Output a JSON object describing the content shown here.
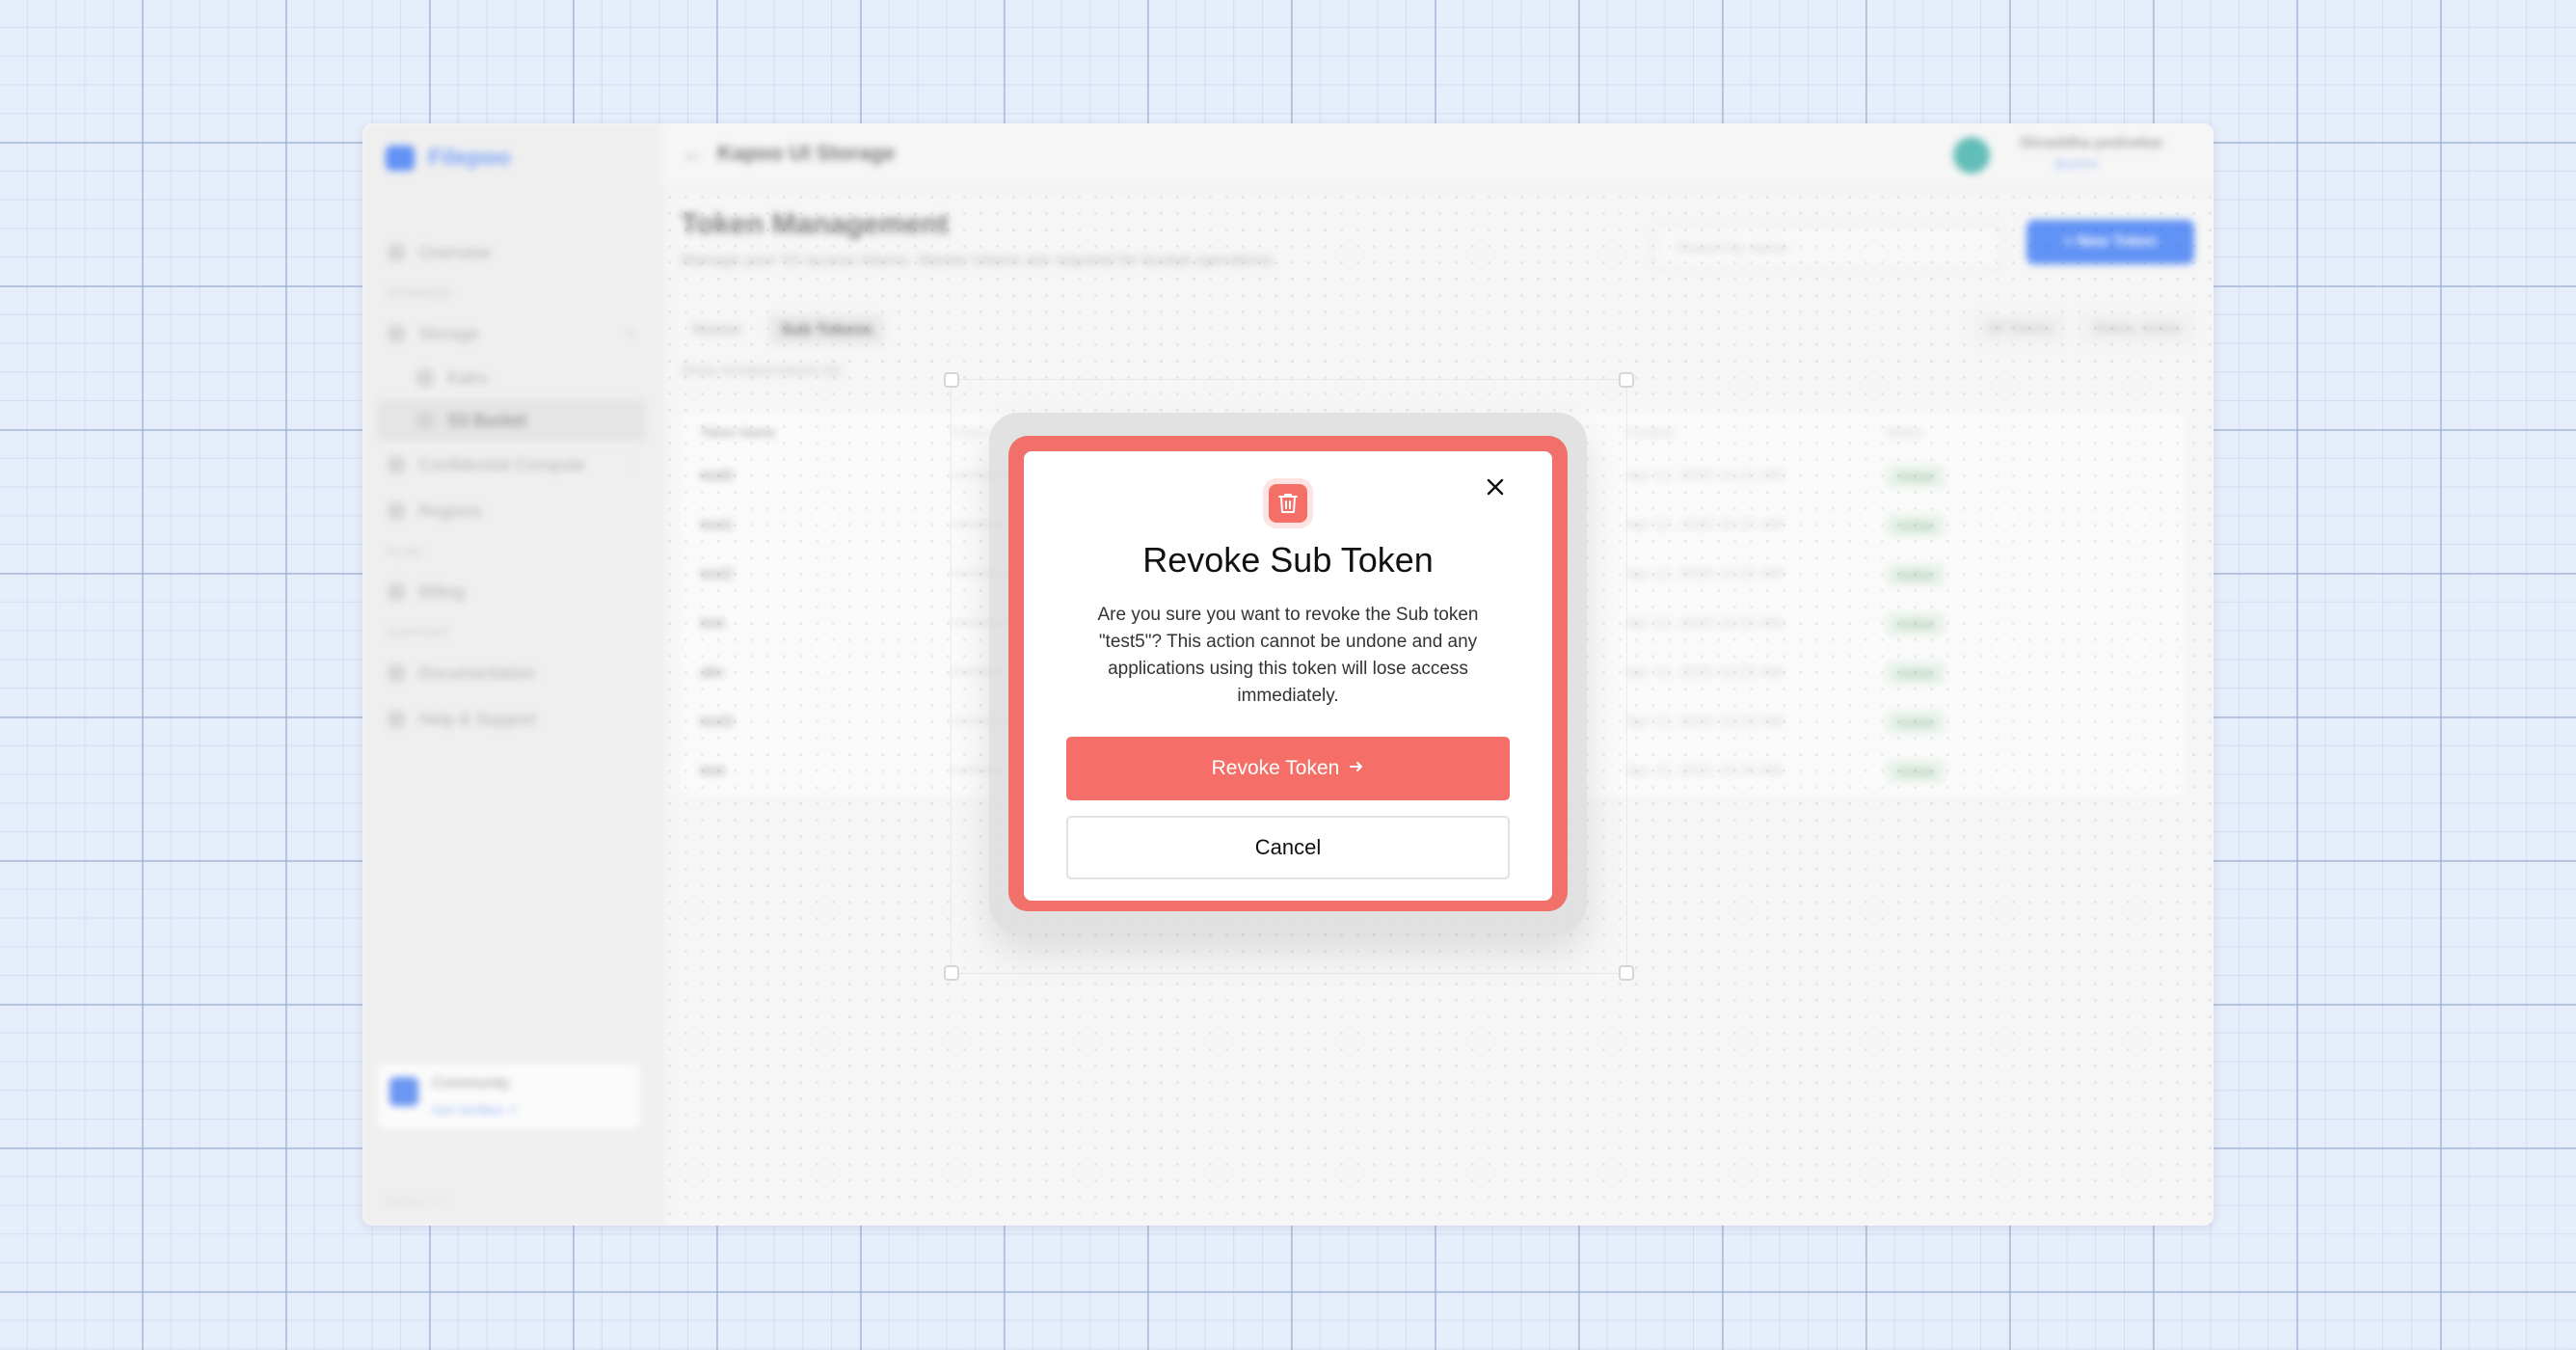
{
  "app": {
    "brand": "Filepoo",
    "page_header_title": "Kapoo UI Storage",
    "user": {
      "name": "Shraddha pednekar",
      "email": "@ashrd"
    },
    "sidebar": {
      "items": [
        {
          "label": "Overview",
          "type": "item"
        },
        {
          "label": "STORAGE",
          "type": "section"
        },
        {
          "label": "Storage",
          "type": "item",
          "chevron": "▾"
        },
        {
          "label": "Kalru",
          "type": "sub"
        },
        {
          "label": "S3 Bucket",
          "type": "sub",
          "active": true
        },
        {
          "label": "Confidential Compute",
          "type": "item",
          "chevron": "›"
        },
        {
          "label": "Regions",
          "type": "item"
        },
        {
          "label": "PLAN",
          "type": "section"
        },
        {
          "label": "Billing",
          "type": "item"
        },
        {
          "label": "SUPPORT",
          "type": "section"
        },
        {
          "label": "Documentation",
          "type": "item"
        },
        {
          "label": "Help & Support",
          "type": "item"
        }
      ],
      "plan_card": {
        "title": "Community",
        "link": "Get Verified ↗"
      },
      "version": "Version 1.0"
    },
    "page": {
      "title": "Token Management",
      "subtitle": "Manage your S3 access tokens. Master tokens are required for bucket operations.",
      "search_placeholder": "Search by name",
      "create_label": "+ New Token",
      "tabs": [
        "Master",
        "Sub Tokens"
      ],
      "filters": [
        "All Tokens",
        "Status: Active"
      ],
      "show_revoked": "Show revoked tokens (0)"
    },
    "table": {
      "headers": [
        "Token Name",
        "Token",
        "Created",
        "Status"
      ],
      "rows": [
        {
          "name": "test0",
          "token": "••••••••••••••••••••••••",
          "created": "Apr 12, 2025 10:21 AM",
          "status": "Active"
        },
        {
          "name": "test1",
          "token": "••••••••••••••••••••••••",
          "created": "Apr 12, 2025 10:21 AM",
          "status": "Active"
        },
        {
          "name": "test2",
          "token": "••••••••••••••••••••••••",
          "created": "Apr 12, 2025 10:22 AM",
          "status": "Active"
        },
        {
          "name": "test",
          "token": "••••••••••••••••••••••••",
          "created": "Apr 12, 2025 10:22 AM",
          "status": "Active"
        },
        {
          "name": "abc",
          "token": "••••••••••••••••••••••••",
          "created": "Apr 12, 2025 10:23 AM",
          "status": "Active"
        },
        {
          "name": "test3",
          "token": "••••••••••••••••••••••••",
          "created": "Apr 12, 2025 10:23 AM",
          "status": "Active"
        },
        {
          "name": "test",
          "token": "••••••••••••••••••••••••",
          "created": "Apr 12, 2025 10:24 AM",
          "status": "Active"
        }
      ]
    }
  },
  "modal": {
    "title": "Revoke Sub Token",
    "body": "Are you sure you want to revoke the Sub token \"test5\"? This action cannot be undone and any applications using this token will lose access immediately.",
    "confirm_label": "Revoke Token",
    "cancel_label": "Cancel",
    "icons": {
      "header": "trash-icon",
      "close": "close-icon",
      "confirm": "arrow-right-icon"
    }
  },
  "colors": {
    "accent": "#f56f68",
    "accent_frame": "#f2706a",
    "primary_blue": "#2c6ef2",
    "canvas_background": "#e6eefc"
  }
}
